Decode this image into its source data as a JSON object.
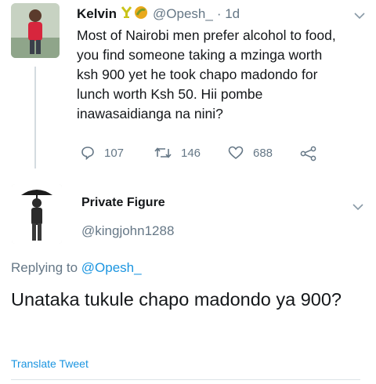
{
  "tweet": {
    "author_name": "Kelvin",
    "handle": "@Opesh_",
    "time": "· 1d",
    "text": "Most of Nairobi men prefer alcohol to food, you find someone taking a mzinga worth ksh 900 yet he took chapo madondo for lunch worth Ksh 50. Hii pombe inawasaidianga na nini?",
    "reply_count": "107",
    "retweet_count": "146",
    "like_count": "688",
    "badge_icons": [
      "trophy-icon",
      "food-emoji-icon"
    ]
  },
  "reply": {
    "author_name": "Private Figure",
    "handle": "@kingjohn1288",
    "replying_prefix": "Replying to ",
    "replying_to": "@Opesh_",
    "text": "Unataka tukule chapo madondo ya 900?",
    "translate_label": "Translate Tweet"
  },
  "colors": {
    "link": "#1b95e0",
    "secondary_text": "#657786",
    "badge": "#c9c31a"
  }
}
